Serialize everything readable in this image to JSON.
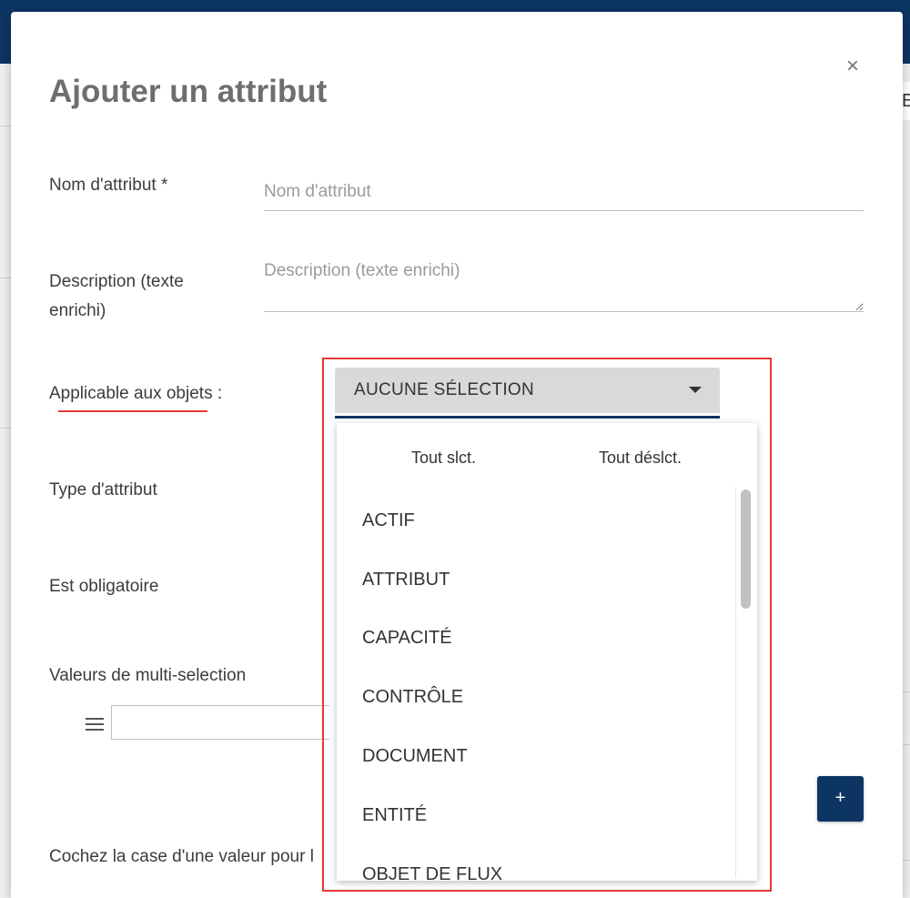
{
  "background": {
    "tab_label": "E"
  },
  "modal": {
    "title": "Ajouter un attribut",
    "close_label": "×"
  },
  "form": {
    "name": {
      "label": "Nom d'attribut *",
      "placeholder": "Nom d'attribut",
      "value": ""
    },
    "description": {
      "label_line1": "Description (texte",
      "label_line2": "enrichi)",
      "placeholder": "Description (texte enrichi)",
      "value": ""
    },
    "applicable": {
      "label": "Applicable aux objets :",
      "selected": "AUCUNE SÉLECTION"
    },
    "type": {
      "label": "Type d'attribut"
    },
    "required": {
      "label": "Est obligatoire"
    },
    "multi": {
      "label": "Valeurs de multi-selection",
      "value": ""
    },
    "add_label": "+",
    "check_hint": "Cochez la case d'une valeur pour l"
  },
  "dropdown": {
    "select_all": "Tout slct.",
    "deselect_all": "Tout déslct.",
    "items": [
      "ACTIF",
      "ATTRIBUT",
      "CAPACITÉ",
      "CONTRÔLE",
      "DOCUMENT",
      "ENTITÉ",
      "OBJET DE FLUX"
    ]
  },
  "colors": {
    "brand": "#0c3563",
    "highlight": "#e53935"
  },
  "icons": {
    "close": "close-icon",
    "caret": "chevron-down-icon",
    "drag": "drag-handle-icon",
    "add": "plus-icon"
  }
}
